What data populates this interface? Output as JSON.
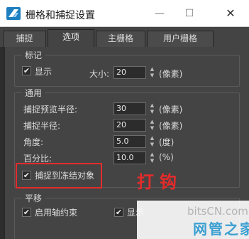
{
  "window": {
    "title": "栅格和捕捉设置",
    "minimize_glyph": "—",
    "maximize_glyph": "☐",
    "close_glyph": "✕"
  },
  "tabs": [
    {
      "label": "捕捉",
      "active": false
    },
    {
      "label": "选项",
      "active": true
    },
    {
      "label": "主栅格",
      "active": false
    },
    {
      "label": "用户栅格",
      "active": false
    }
  ],
  "marks": {
    "group_title": "标记",
    "show_label": "显示",
    "show_checked": true,
    "size_label": "大小:",
    "size_value": "20",
    "size_unit": "(像素)"
  },
  "general": {
    "group_title": "通用",
    "snap_preview_radius_label": "捕捉预览半径:",
    "snap_preview_radius_value": "30",
    "snap_preview_radius_unit": "(像素)",
    "snap_radius_label": "捕捉半径:",
    "snap_radius_value": "20",
    "snap_radius_unit": "(像素)",
    "angle_label": "角度:",
    "angle_value": "5.0",
    "angle_unit": "(度)",
    "percent_label": "百分比:",
    "percent_value": "10.0",
    "percent_unit": "(%)",
    "snap_frozen_label": "捕捉到冻结对象",
    "snap_frozen_checked": true
  },
  "translation": {
    "group_title": "平移",
    "axis_constraint_label": "启用轴约束",
    "axis_constraint_checked": true,
    "show_label": "显示",
    "show_checked": true
  },
  "annotation": {
    "text": "打钩",
    "color": "#e42b2b"
  },
  "watermark": {
    "site": "bitsCN.com",
    "logo": "网管之家"
  },
  "check_glyph": "✔",
  "spin_up_glyph": "▲",
  "spin_down_glyph": "▼"
}
